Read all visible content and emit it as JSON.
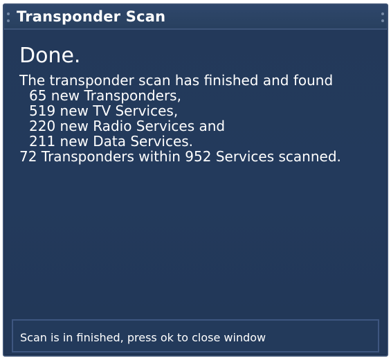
{
  "window": {
    "title": "Transponder Scan"
  },
  "result": {
    "heading": "Done.",
    "summary": "The transponder scan has finished and found",
    "found": [
      "65 new Transponders,",
      "519 new TV Services,",
      "220 new Radio Services and",
      "211 new Data Services."
    ],
    "totals": "72 Transponders within 952 Services scanned."
  },
  "status": {
    "message": "Scan is in finished, press ok to close window"
  },
  "colors": {
    "background": "#233a5c",
    "border": "#3d5479",
    "text": "#ffffff"
  }
}
